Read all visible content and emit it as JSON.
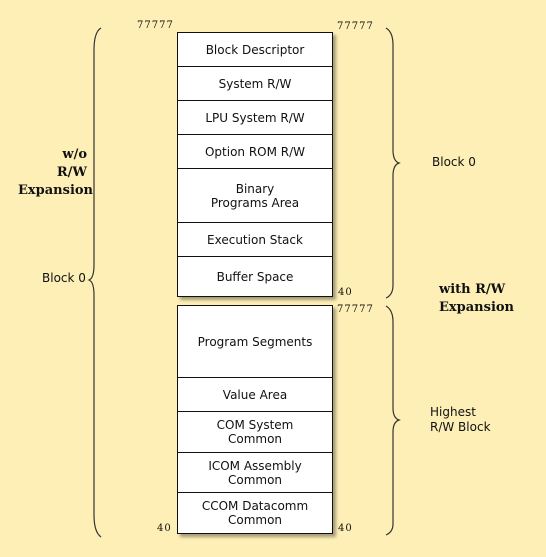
{
  "upper_block": {
    "top_address_left": "77777",
    "top_address_right": "77777",
    "bottom_address_right": "40",
    "segments": [
      "Block Descriptor",
      "System R/W",
      "LPU System R/W",
      "Option ROM R/W",
      "Binary Programs Area",
      "Execution Stack",
      "Buffer Space"
    ]
  },
  "lower_block": {
    "top_address_right": "77777",
    "bottom_address_left": "40",
    "bottom_address_right": "40",
    "segments": [
      "Program Segments",
      "Value Area",
      "COM System Common",
      "ICOM Assembly Common",
      "CCOM Datacomm Common"
    ]
  },
  "left_annotation": {
    "title_line1": "w/o R/W",
    "title_line2": "Expansion",
    "brace_label": "Block 0"
  },
  "right_annotation": {
    "upper_brace_label": "Block 0",
    "title_line1": "with R/W",
    "title_line2": "Expansion",
    "lower_brace_label_line1": "Highest",
    "lower_brace_label_line2": "R/W Block"
  }
}
